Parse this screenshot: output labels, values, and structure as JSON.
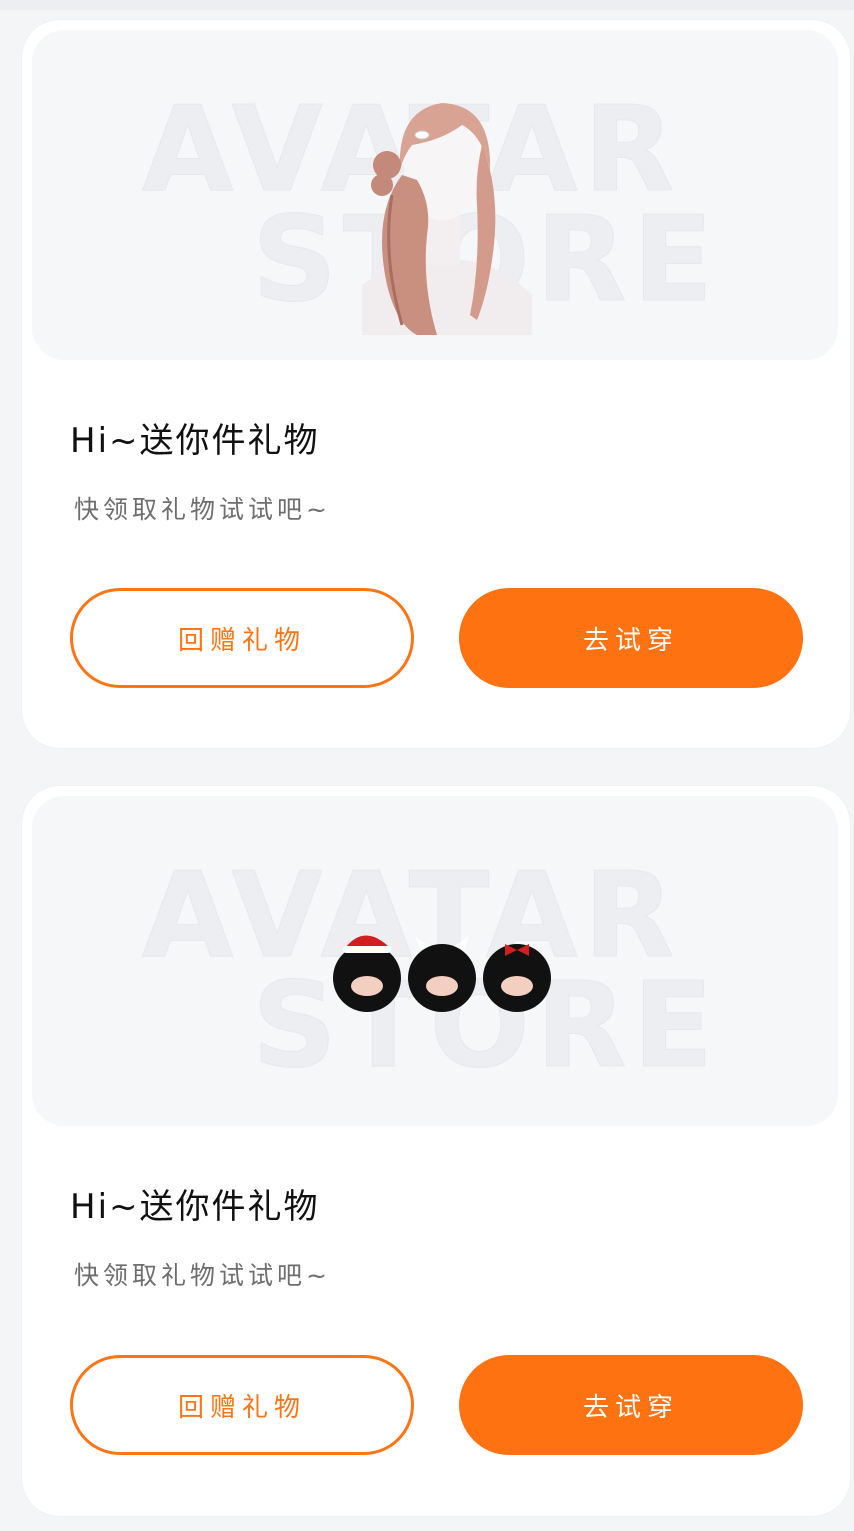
{
  "watermark": {
    "line1": "AVATAR",
    "line2": "STORE"
  },
  "cards": [
    {
      "item": "hair-ponytail",
      "title": "Hi~送你件礼物",
      "subtitle": "快领取礼物试试吧~",
      "return_gift_label": "回赠礼物",
      "try_on_label": "去试穿"
    },
    {
      "item": "three-fluffy-pets",
      "title": "Hi~送你件礼物",
      "subtitle": "快领取礼物试试吧~",
      "return_gift_label": "回赠礼物",
      "try_on_label": "去试穿"
    }
  ],
  "colors": {
    "accent": "#ff7516",
    "background": "#f4f5f7",
    "card": "#ffffff"
  }
}
